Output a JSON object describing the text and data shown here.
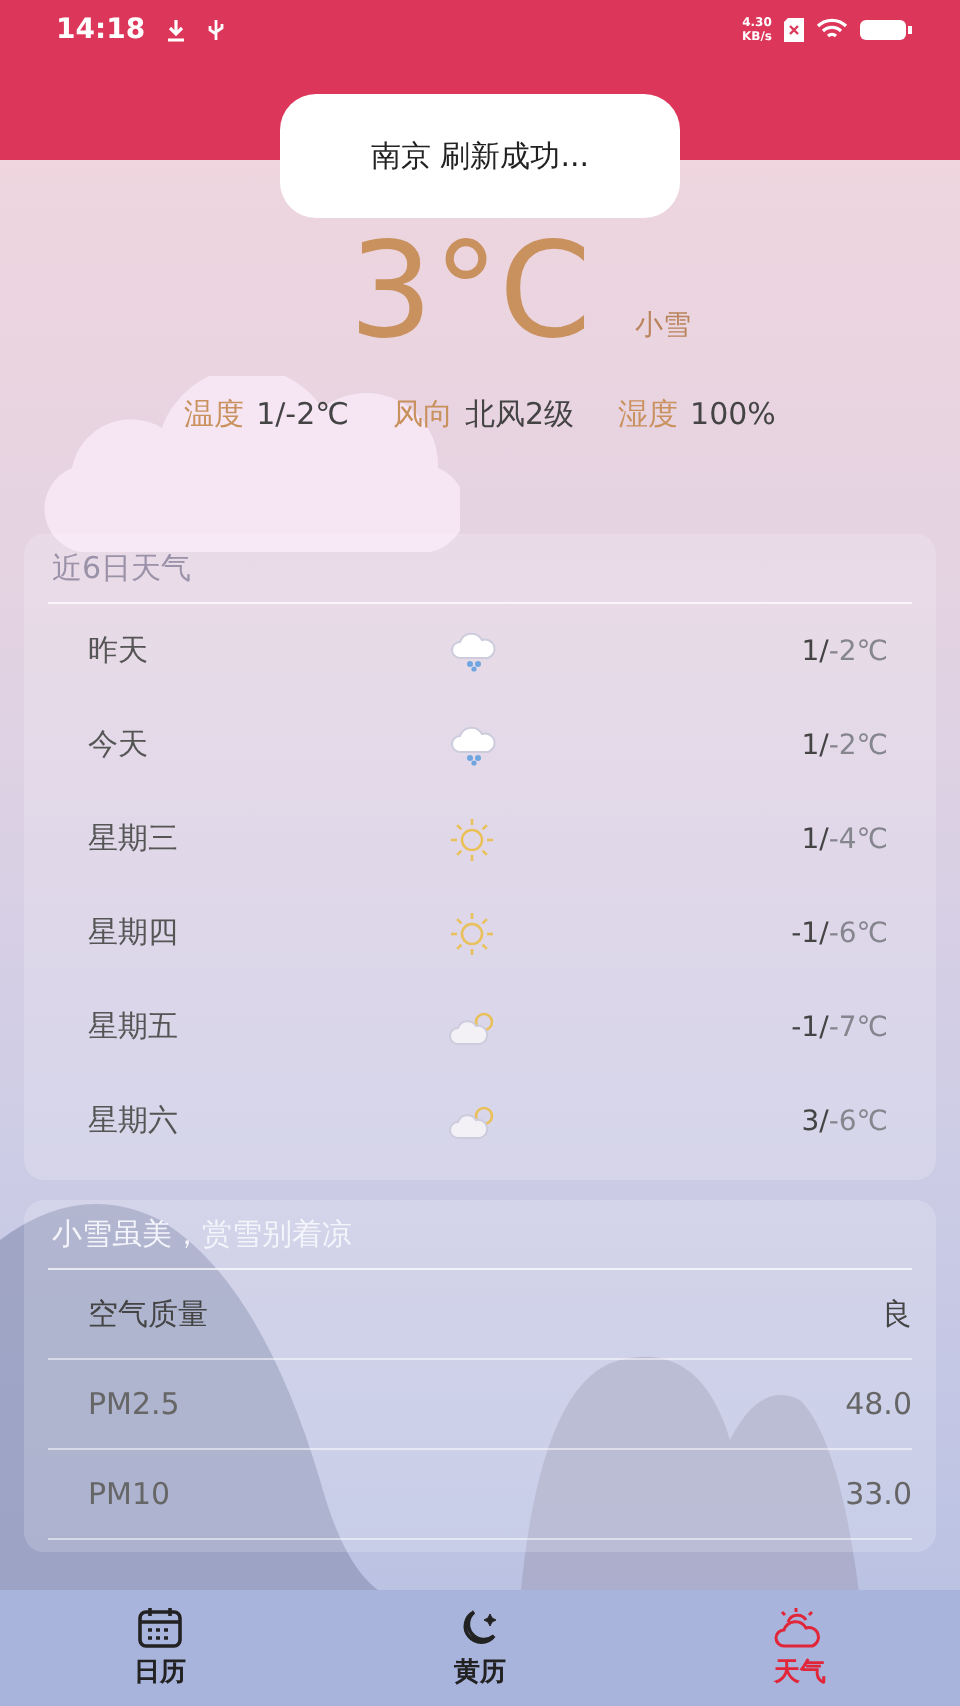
{
  "status_bar": {
    "time": "14:18",
    "net_speed": "4.30\nKB/s"
  },
  "toast": {
    "message": "南京 刷新成功..."
  },
  "current": {
    "temperature": "3",
    "unit": "°C",
    "condition": "小雪"
  },
  "stats": [
    {
      "label": "温度",
      "value": "1/-2℃"
    },
    {
      "label": "风向",
      "value": "北风2级"
    },
    {
      "label": "湿度",
      "value": "100%"
    }
  ],
  "forecast": {
    "title": "近6日天气",
    "days": [
      {
        "day": "昨天",
        "kind": "snow",
        "high": "1/",
        "low": "-2℃"
      },
      {
        "day": "今天",
        "kind": "snow",
        "high": "1/",
        "low": "-2℃"
      },
      {
        "day": "星期三",
        "kind": "sunny",
        "high": "1/",
        "low": "-4℃"
      },
      {
        "day": "星期四",
        "kind": "sunny",
        "high": "-1/",
        "low": "-6℃"
      },
      {
        "day": "星期五",
        "kind": "partly-cloudy",
        "high": "-1/",
        "low": "-7℃"
      },
      {
        "day": "星期六",
        "kind": "partly-cloudy",
        "high": "3/",
        "low": "-6℃"
      }
    ]
  },
  "air": {
    "title": "小雪虽美，赏雪别着凉",
    "rows": [
      {
        "label": "空气质量",
        "value": "良",
        "kind": "main"
      },
      {
        "label": "PM2.5",
        "value": "48.0",
        "kind": "sub"
      },
      {
        "label": "PM10",
        "value": "33.0",
        "kind": "sub"
      }
    ]
  },
  "tab_bar": [
    {
      "label": "日历",
      "kind": "calendar",
      "selected": false
    },
    {
      "label": "黄历",
      "kind": "moon",
      "selected": false
    },
    {
      "label": "天气",
      "kind": "weather",
      "selected": true
    }
  ]
}
